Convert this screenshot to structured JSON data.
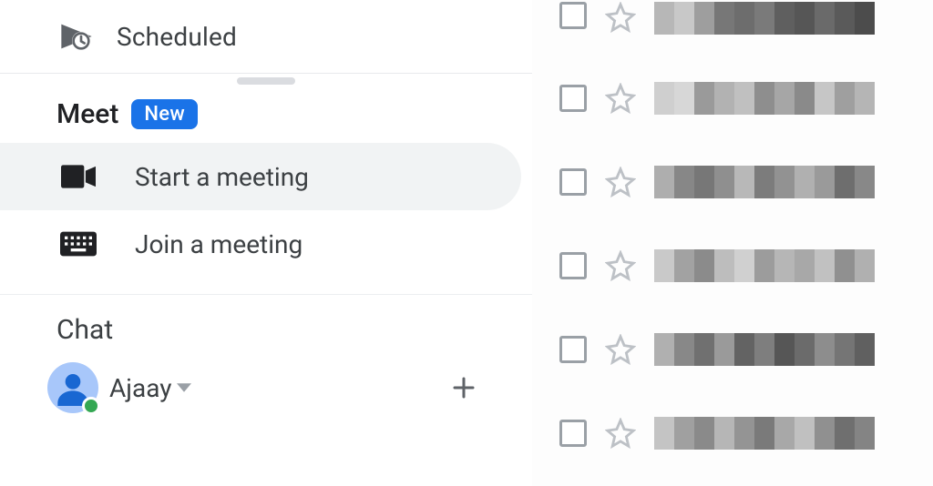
{
  "sidebar": {
    "scheduled_label": "Scheduled",
    "meet": {
      "title": "Meet",
      "badge": "New",
      "start_label": "Start a meeting",
      "join_label": "Join a meeting"
    },
    "chat": {
      "title": "Chat",
      "user_name": "Ajaay"
    }
  }
}
